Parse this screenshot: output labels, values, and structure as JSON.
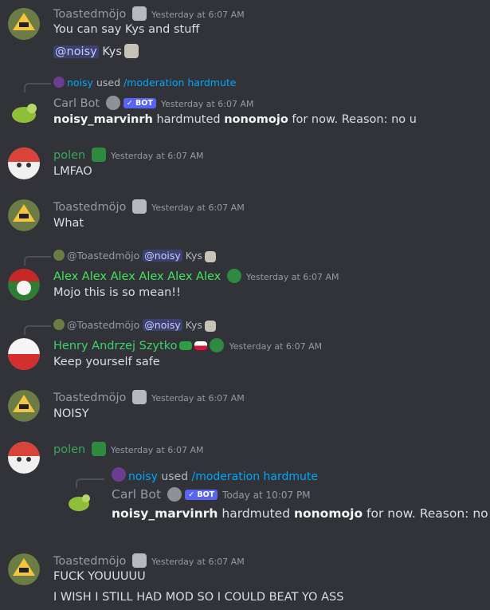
{
  "messages": [
    {
      "author": "Toastedmöjo",
      "ts": "Yesterday at 6:07 AM",
      "lines": [
        "You can say Kys and stuff"
      ],
      "extra_mention": "@noisy",
      "extra_text": "Kys"
    },
    {
      "reply_user": "noisy",
      "reply_used": "used",
      "reply_cmd": "/moderation hardmute",
      "author": "Carl Bot",
      "badge": "BOT",
      "ts": "Yesterday at 6:07 AM",
      "t1": "noisy_marvinrh",
      "t2": " hardmuted ",
      "t3": "nonomojo",
      "t4": " for now. Reason: no u"
    },
    {
      "author": "polen",
      "ts": "Yesterday at 6:07 AM",
      "lines": [
        "LMFAO"
      ]
    },
    {
      "author": "Toastedmöjo",
      "ts": "Yesterday at 6:07 AM",
      "lines": [
        "What"
      ]
    },
    {
      "reply_user": "@Toastedmöjo",
      "reply_mention": "@noisy",
      "reply_text": "Kys",
      "author": "Alex Alex Alex Alex Alex Alex",
      "ts": "Yesterday at 6:07 AM",
      "lines": [
        "Mojo this is so mean!!"
      ]
    },
    {
      "reply_user": "@Toastedmöjo",
      "reply_mention": "@noisy",
      "reply_text": "Kys",
      "author": "Henry Andrzej Szytko",
      "ts": "Yesterday at 6:07 AM",
      "lines": [
        "Keep yourself safe"
      ]
    },
    {
      "author": "Toastedmöjo",
      "ts": "Yesterday at 6:07 AM",
      "lines": [
        "NOISY"
      ]
    },
    {
      "author": "polen",
      "ts": "Yesterday at 6:07 AM",
      "embed": {
        "reply_user": "noisy",
        "reply_used": "used",
        "reply_cmd": "/moderation hardmute",
        "author": "Carl Bot",
        "badge": "BOT",
        "ts": "Today at 10:07 PM",
        "t1": "noisy_marvinrh",
        "t2": " hardmuted ",
        "t3": "nonomojo",
        "t4": " for now. Reason: no u"
      }
    },
    {
      "author": "Toastedmöjo",
      "ts": "Yesterday at 6:07 AM",
      "lines": [
        "FUCK YOUUUUU",
        "I WISH I STILL HAD MOD SO I COULD BEAT YO ASS"
      ]
    }
  ],
  "colors": {
    "toasted": "#949ba4",
    "carl": "#949ba4",
    "polen": "#3ba55c",
    "alex": "#43e55e",
    "henry": "#3fd36a"
  }
}
